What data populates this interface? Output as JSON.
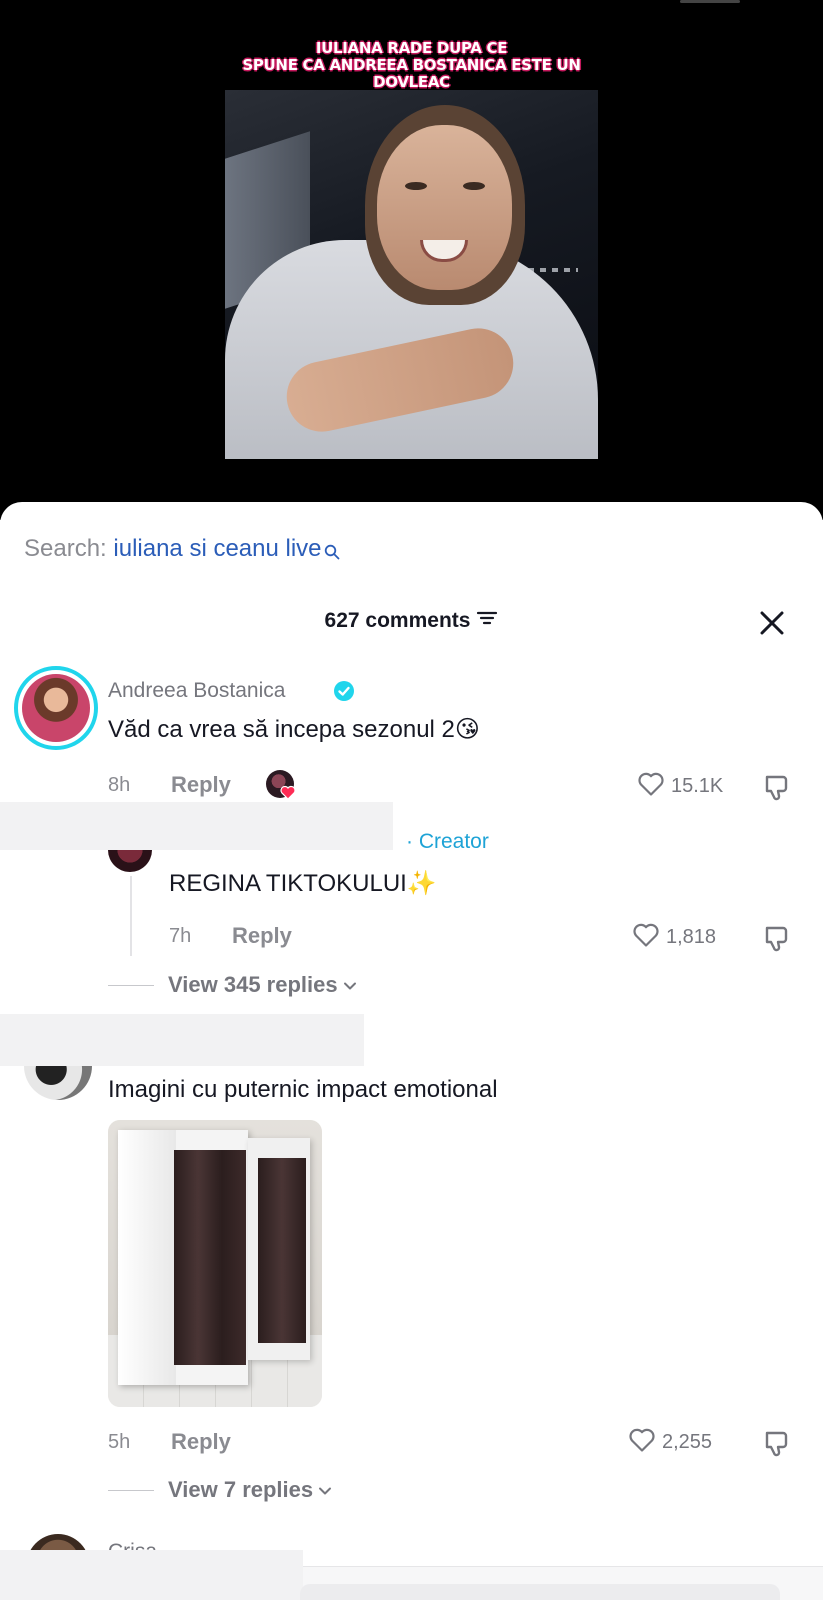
{
  "video": {
    "caption_lines": [
      "IULIANA RADE DUPA CE",
      "SPUNE CA ANDREEA BOSTANICA ESTE UN",
      "DOVLEAC"
    ]
  },
  "search": {
    "label": "Search:",
    "query": "iuliana si ceanu live"
  },
  "comments_header": {
    "count_label": "627 comments"
  },
  "comments": [
    {
      "username": "Andreea Bostanica",
      "verified": true,
      "text": "Văd ca vrea să incepa sezonul 2",
      "emoji": "😘",
      "time": "8h",
      "reply_label": "Reply",
      "likes": "15.1K",
      "replies": [
        {
          "creator_label": "· Creator",
          "text": "REGINA TIKTOKULUI",
          "emoji": "✨",
          "time": "7h",
          "reply_label": "Reply",
          "likes": "1,818"
        }
      ],
      "view_replies": "View 345 replies"
    },
    {
      "text": "Imagini cu puternic impact emotional",
      "time": "5h",
      "reply_label": "Reply",
      "likes": "2,255",
      "view_replies": "View 7 replies"
    },
    {
      "username_partial": "Crisa"
    }
  ],
  "colors": {
    "accent_link": "#2b5db8",
    "creator": "#1ea3d6",
    "caption_outline": "#c2185b",
    "verified": "#20d5ec"
  },
  "icons": [
    "search-icon",
    "sort-icon",
    "close-icon",
    "verified-icon",
    "heart-icon",
    "dislike-icon",
    "chevron-down-icon"
  ]
}
